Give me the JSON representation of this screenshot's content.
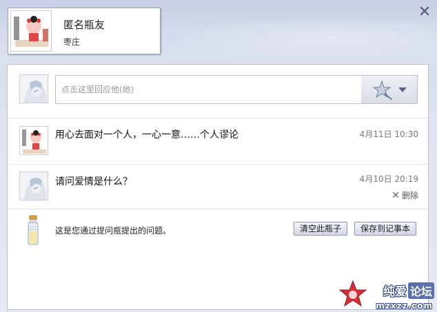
{
  "profile": {
    "name": "匿名瓶友",
    "location": "枣庄"
  },
  "reply": {
    "placeholder": "点击这里回应他(她)"
  },
  "messages": [
    {
      "text": "用心去面对一个人，一心一意……个人谬论",
      "time": "4月11日 10:30"
    },
    {
      "text": "请问爱情是什么？",
      "time": "4月10日 20:19",
      "delete_label": "删除"
    }
  ],
  "footer": {
    "text": "这是您通过提问瓶提出的问题。",
    "clear_label": "清空此瓶子",
    "save_label": "保存到记事本"
  },
  "watermark": {
    "name": "纯爱",
    "forum": "论坛",
    "url": "mzxzz.com"
  },
  "icons": {
    "close": "close-icon",
    "emoji": "star-wand-icon",
    "dropdown": "chevron-down-icon",
    "bottle": "bottle-icon",
    "delete": "x-icon"
  }
}
